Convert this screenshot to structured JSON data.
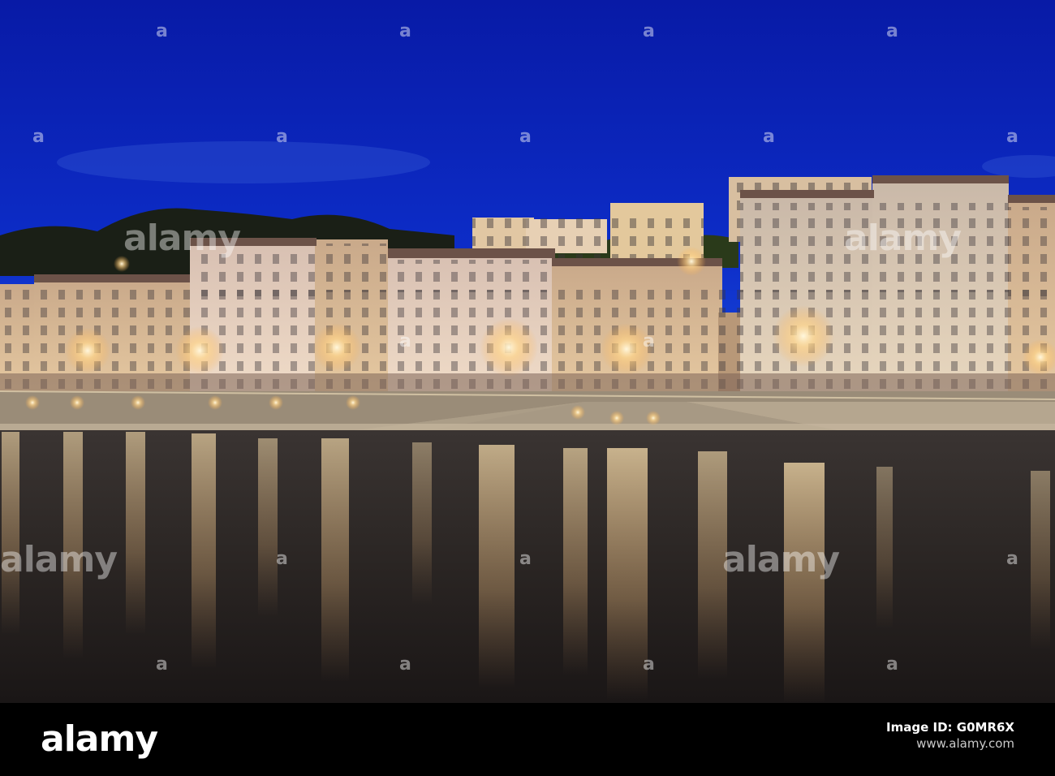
{
  "scene": {
    "subject": "Night view of riverside buildings with lights reflected in the river",
    "palette": {
      "sky_top": "#0a1fb0",
      "sky_bottom": "#1a47d8",
      "water": "#2a2525",
      "light_glow": "#ffd79a",
      "quay_stone": "#b8a991"
    }
  },
  "watermark": {
    "text": "alamy",
    "marker": "a"
  },
  "footer": {
    "logo": "alamy",
    "image_id_label": "Image ID: G0MR6X",
    "url": "www.alamy.com"
  }
}
